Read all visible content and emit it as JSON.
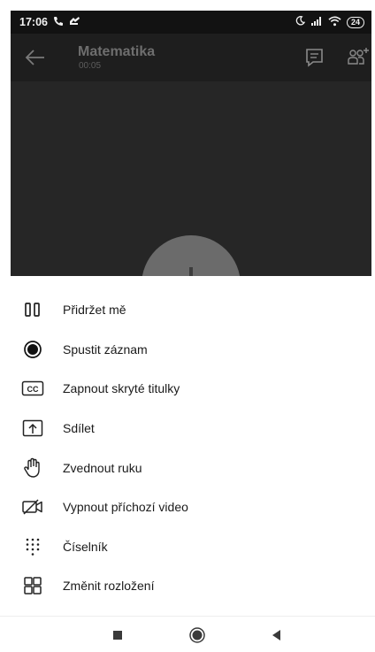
{
  "status_bar": {
    "time": "17:06",
    "battery": "24"
  },
  "call": {
    "title": "Matematika",
    "duration": "00:05"
  },
  "menu": {
    "items": [
      {
        "label": "Přidržet mě",
        "icon": "pause-icon"
      },
      {
        "label": "Spustit záznam",
        "icon": "record-icon"
      },
      {
        "label": "Zapnout skryté titulky",
        "icon": "closed-captions-icon"
      },
      {
        "label": "Sdílet",
        "icon": "share-screen-icon"
      },
      {
        "label": "Zvednout ruku",
        "icon": "raise-hand-icon"
      },
      {
        "label": "Vypnout příchozí video",
        "icon": "video-off-icon"
      },
      {
        "label": "Číselník",
        "icon": "dialpad-icon"
      },
      {
        "label": "Změnit rozložení",
        "icon": "layout-grid-icon"
      }
    ]
  },
  "colors": {
    "status_bar_bg": "#121212",
    "call_header_bg": "#1e1e1e",
    "video_bg": "#262626",
    "menu_text": "#1a1a1a"
  }
}
